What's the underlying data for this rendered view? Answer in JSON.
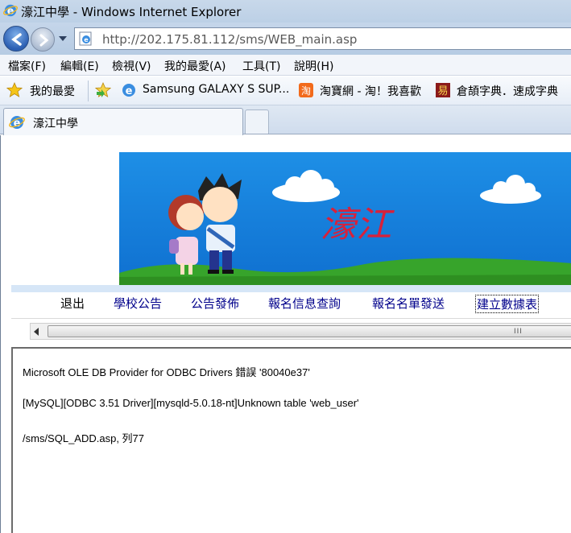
{
  "window": {
    "title": "濠江中學 - Windows Internet Explorer",
    "url": "http://202.175.81.112/sms/WEB_main.asp"
  },
  "menu": [
    "檔案(F)",
    "編輯(E)",
    "檢視(V)",
    "我的最愛(A)",
    "工具(T)",
    "說明(H)"
  ],
  "favorites": {
    "main": "我的最愛",
    "items": [
      "Samsung GALAXY S SUP...",
      "淘寶網 - 淘！我喜歡",
      "倉頡字典．速成字典"
    ]
  },
  "tab": {
    "label": "濠江中學"
  },
  "banner": {
    "logo_text": "濠江"
  },
  "nav": {
    "links": [
      "退出",
      "學校公告",
      "公告發佈",
      "報名信息查詢",
      "報名名單發送",
      "建立數據表"
    ]
  },
  "error": {
    "line1": "Microsoft OLE DB Provider for ODBC Drivers 錯誤 '80040e37'",
    "line2": "[MySQL][ODBC 3.51 Driver][mysqld-5.0.18-nt]Unknown table 'web_user'",
    "line3": "/sms/SQL_ADD.asp, 列77"
  },
  "scrollbar": {
    "grip": "III"
  }
}
